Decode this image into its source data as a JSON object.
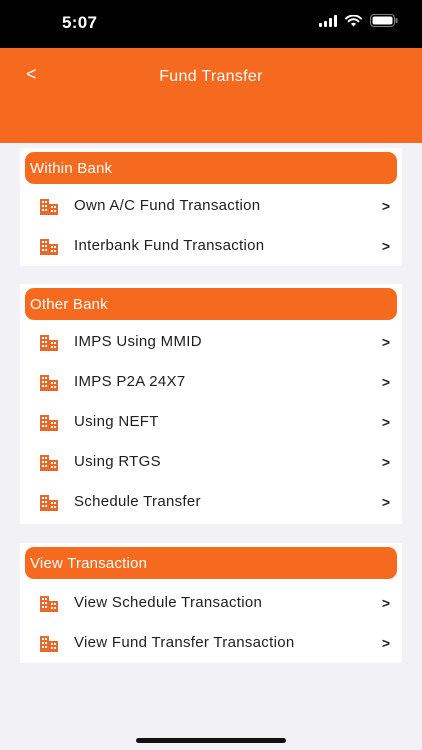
{
  "status": {
    "time": "5:07"
  },
  "header": {
    "back_label": "<",
    "title": "Fund Transfer"
  },
  "sections": [
    {
      "title": "Within Bank",
      "items": [
        {
          "label": "Own A/C Fund Transaction",
          "chevron": ">"
        },
        {
          "label": "Interbank Fund Transaction",
          "chevron": ">"
        }
      ]
    },
    {
      "title": "Other Bank",
      "items": [
        {
          "label": "IMPS Using MMID",
          "chevron": ">"
        },
        {
          "label": "IMPS P2A 24X7",
          "chevron": ">"
        },
        {
          "label": "Using NEFT",
          "chevron": ">"
        },
        {
          "label": "Using RTGS",
          "chevron": ">"
        },
        {
          "label": "Schedule Transfer",
          "chevron": ">"
        }
      ]
    },
    {
      "title": "View Transaction",
      "items": [
        {
          "label": "View Schedule Transaction",
          "chevron": ">"
        },
        {
          "label": "View Fund Transfer Transaction",
          "chevron": ">"
        }
      ]
    }
  ],
  "colors": {
    "accent": "#f56a1e",
    "background": "#f2f1f6"
  }
}
